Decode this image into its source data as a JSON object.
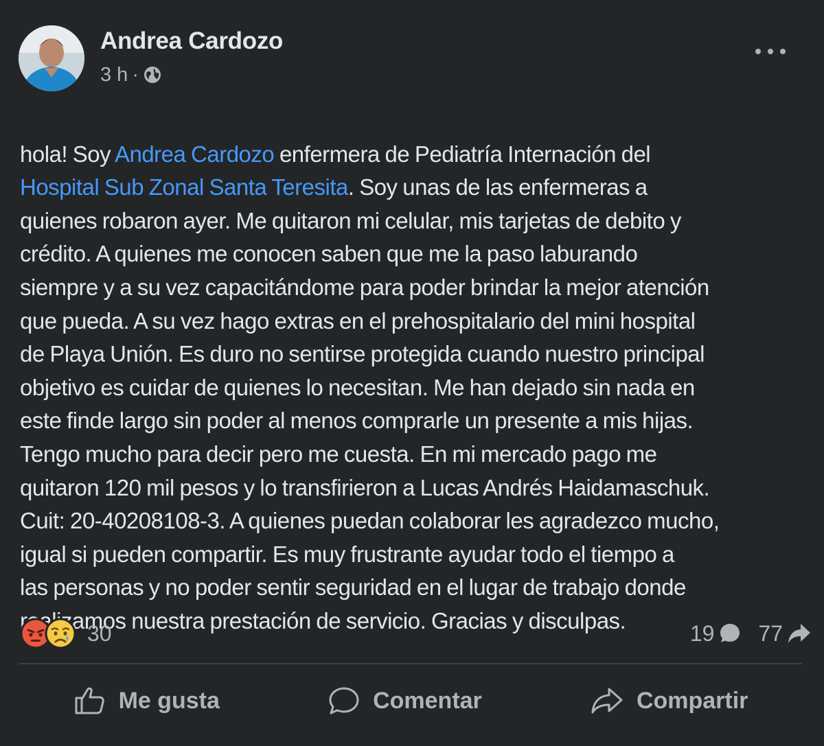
{
  "post": {
    "author": "Andrea Cardozo",
    "time": "3 h",
    "separator": "·",
    "privacy_icon": "globe-icon",
    "body": [
      {
        "text": "hola! Soy ",
        "type": "text"
      },
      {
        "text": "Andrea Cardozo",
        "type": "mention"
      },
      {
        "text": " enfermera de Pediatría Internación del\n",
        "type": "text"
      },
      {
        "text": "Hospital Sub Zonal Santa Teresita",
        "type": "mention"
      },
      {
        "text": ". Soy unas de las enfermeras a\nquienes robaron ayer. Me quitaron mi celular, mis tarjetas de debito y\ncrédito. A quienes me conocen saben que me la paso laburando\nsiempre y a su vez capacitándome para poder brindar la mejor atención\nque pueda. A su vez hago extras en el prehospitalario del mini hospital\nde Playa Unión. Es duro no sentirse protegida cuando nuestro principal\nobjetivo es cuidar de quienes lo necesitan. Me han dejado sin nada en\neste finde largo sin poder al menos comprarle un presente a mis hijas.\nTengo mucho para decir pero me cuesta. En mi mercado pago me\nquitaron 120 mil pesos y lo transfirieron a Lucas Andrés Haidamaschuk.\nCuit: 20-40208108-3. A quienes puedan colaborar les agradezco mucho,\nigual si pueden compartir. Es muy frustrante ayudar todo el tiempo a\nlas personas y no poder sentir seguridad en el lugar de trabajo donde\nrealizamos nuestra prestación de servicio. Gracias y disculpas.",
        "type": "text"
      }
    ]
  },
  "reactions": {
    "icons": [
      "angry-reaction-icon",
      "sad-reaction-icon"
    ],
    "count": "30"
  },
  "stats": {
    "comments": "19",
    "shares": "77"
  },
  "actions": {
    "like": "Me gusta",
    "comment": "Comentar",
    "share": "Compartir"
  },
  "colors": {
    "background": "#242526",
    "text": "#e4e6eb",
    "secondary": "#b0b3b8",
    "link": "#4599ff",
    "divider": "#3e4042"
  }
}
